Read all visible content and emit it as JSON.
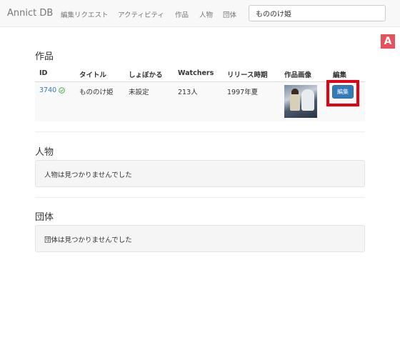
{
  "navbar": {
    "brand": "Annict DB",
    "links": [
      "編集リクエスト",
      "アクティビティ",
      "作品",
      "人物",
      "団体"
    ],
    "search": {
      "value": "もののけ姫",
      "placeholder": ""
    }
  },
  "logo": {
    "letter": "A",
    "color": "#e8505b"
  },
  "works": {
    "title": "作品",
    "headers": [
      "ID",
      "タイトル",
      "しょぼかる",
      "Watchers",
      "リリース時期",
      "作品画像",
      "編集"
    ],
    "rows": [
      {
        "id": "3740",
        "verified_icon": "check-circle-icon",
        "title": "もののけ姫",
        "syobocal": "未設定",
        "watchers": "213人",
        "release": "1997年夏",
        "image": "work-thumbnail",
        "edit_label": "編集"
      }
    ]
  },
  "people": {
    "title": "人物",
    "empty": "人物は見つかりませんでした"
  },
  "organizations": {
    "title": "団体",
    "empty": "団体は見つかりませんでした"
  },
  "colors": {
    "link": "#337ab7",
    "primary": "#337ab7",
    "highlight": "#e60012",
    "success": "#5cb85c"
  }
}
